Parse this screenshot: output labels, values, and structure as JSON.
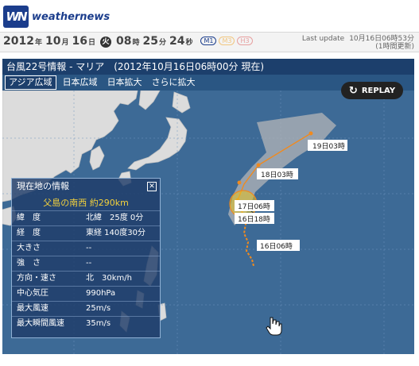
{
  "header": {
    "logo_mark": "WN",
    "brand": "weathernews"
  },
  "clock": {
    "year": "2012",
    "year_unit": "年",
    "month": "10",
    "month_unit": "月",
    "day": "16",
    "day_unit": "日",
    "weekday": "火",
    "hour": "08",
    "hour_unit": "時",
    "minute": "25",
    "minute_unit": "分",
    "second": "24",
    "second_unit": "秒",
    "badges": [
      "M1",
      "M3",
      "H3"
    ],
    "last_update_label": "Last update",
    "last_update_value": "10月16日06時53分",
    "last_update_sub": "(1時間更新)"
  },
  "panel": {
    "title": "台風22号情報 - マリア　(2012年10月16日06時00分 現在)",
    "tabs": [
      "アジア広域",
      "日本広域",
      "日本拡大",
      "さらに拡大"
    ],
    "replay_label": "REPLAY",
    "replay_icon": "replay-arrow-icon"
  },
  "map": {
    "track_labels": [
      "19日03時",
      "18日03時",
      "17日06時",
      "16日18時",
      "16日06時"
    ],
    "colors": {
      "ocean": "#3d6a96",
      "land": "#dcdcdc",
      "forecast_cone": "#b8b8b8",
      "track": "#f08a1e"
    },
    "cursor_icon": "hand-cursor-icon"
  },
  "info": {
    "title": "現在地の情報",
    "close_icon": "close-icon",
    "location": "父島の南西 約290km",
    "rows": [
      {
        "key": "緯　度",
        "value": "北緯　25度 0分"
      },
      {
        "key": "経　度",
        "value": "東経 140度30分"
      },
      {
        "key": "大きさ",
        "value": "--"
      },
      {
        "key": "強　さ",
        "value": "--"
      },
      {
        "key": "方向・速さ",
        "value": "北　30km/h"
      },
      {
        "key": "中心気圧",
        "value": "990hPa"
      },
      {
        "key": "最大風速",
        "value": "25m/s"
      },
      {
        "key": "最大瞬間風速",
        "value": "35m/s"
      }
    ]
  }
}
